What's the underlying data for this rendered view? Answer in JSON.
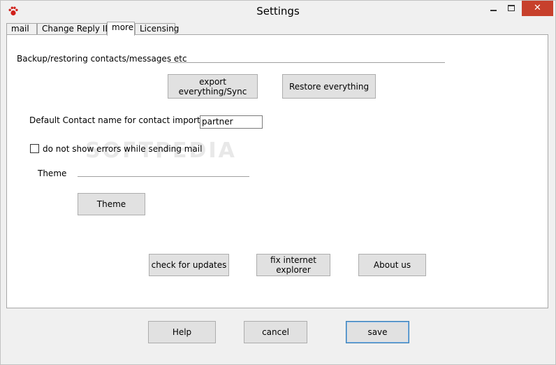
{
  "window": {
    "title": "Settings",
    "controls": {
      "minimize": "–",
      "maximize": "□",
      "close": "✕"
    }
  },
  "tabs": [
    {
      "label": "mail"
    },
    {
      "label": "Change Reply ID"
    },
    {
      "label": "more",
      "active": true
    },
    {
      "label": "Licensing"
    }
  ],
  "panel": {
    "backup_label": "Backup/restoring contacts/messages etc",
    "export_button": "export everything/Sync",
    "restore_button": "Restore everything",
    "default_contact_label": "Default Contact name for contact imports",
    "default_contact_value": "partner",
    "errors_checkbox_label": "do not show errors while sending mail",
    "errors_checkbox_checked": false,
    "theme_label": "Theme",
    "theme_button": "Theme",
    "updates_button": "check for updates",
    "fix_ie_button": "fix internet explorer",
    "about_button": "About us",
    "watermark": "SOFTPEDIA"
  },
  "footer": {
    "help_button": "Help",
    "cancel_button": "cancel",
    "save_button": "save"
  },
  "colors": {
    "close_button": "#c7402c",
    "window_bg": "#f0f0f0",
    "button_bg": "#e1e1e1",
    "focus_border": "#3c7fb1"
  },
  "icons": {
    "app": "paw-icon"
  }
}
